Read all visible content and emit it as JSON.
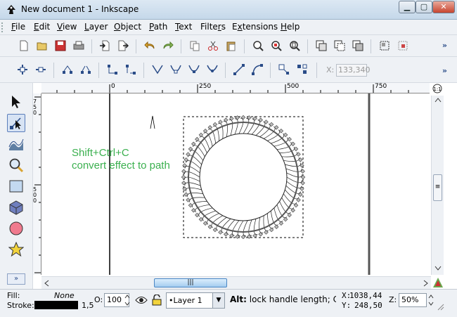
{
  "window": {
    "title": "New document 1 - Inkscape"
  },
  "menu": [
    "File",
    "Edit",
    "View",
    "Layer",
    "Object",
    "Path",
    "Text",
    "Filters",
    "Extensions",
    "Help"
  ],
  "menu_underlines": [
    "F",
    "E",
    "V",
    "L",
    "O",
    "P",
    "T",
    "r",
    "x",
    "H"
  ],
  "toolbar": {
    "x_label": "X:",
    "x_value": "133,340"
  },
  "rulers": {
    "top": [
      "0",
      "250",
      "500",
      "750"
    ],
    "left": [
      "750",
      "500"
    ]
  },
  "canvas": {
    "note_line1": "Shift+Ctrl+C",
    "note_line2": "convert effect to path"
  },
  "status": {
    "fill_label": "Fill:",
    "fill_value": "None",
    "stroke_label": "Stroke:",
    "stroke_width": "1,5",
    "opacity_label": "O:",
    "opacity_value": "100",
    "layer": "•Layer 1",
    "message_bold": "Alt:",
    "message": " lock handle length; Ctrl+",
    "x_label": "X:",
    "x_value": "1038,44",
    "y_label": "Y:",
    "y_value": "248,50",
    "zoom_label": "Z:",
    "zoom_value": "50%"
  },
  "colors": {
    "note": "#3bb04f",
    "accent": "#5a7dbb"
  }
}
